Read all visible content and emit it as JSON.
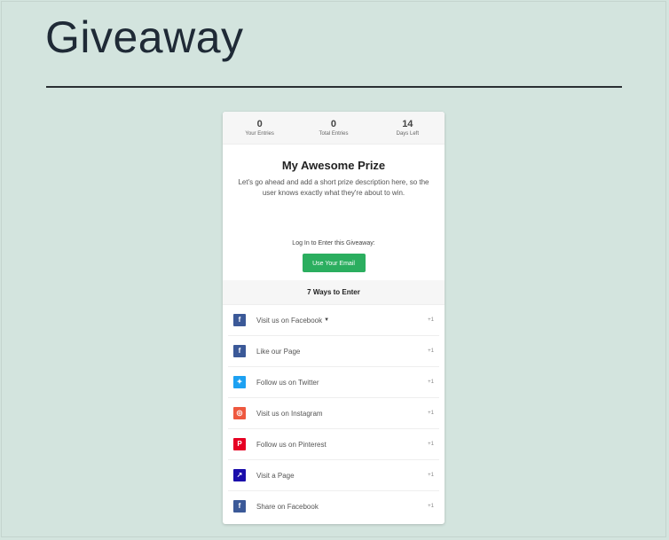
{
  "page": {
    "title": "Giveaway"
  },
  "stats": [
    {
      "value": "0",
      "label": "Your Entries"
    },
    {
      "value": "0",
      "label": "Total Entries"
    },
    {
      "value": "14",
      "label": "Days Left"
    }
  ],
  "prize": {
    "title": "My Awesome Prize",
    "description": "Let's go ahead and add a short prize description here, so the user knows exactly what they're about to win."
  },
  "login": {
    "label": "Log In to Enter this Giveaway:",
    "email_button": "Use Your Email"
  },
  "ways": {
    "header": "7 Ways to Enter",
    "items": [
      {
        "label": "Visit us on Facebook",
        "points": "+1",
        "icon": "facebook-icon",
        "color": "#3b5998",
        "glyph": "f",
        "expandable": true
      },
      {
        "label": "Like our Page",
        "points": "+1",
        "icon": "facebook-icon",
        "color": "#3b5998",
        "glyph": "f"
      },
      {
        "label": "Follow us on Twitter",
        "points": "+1",
        "icon": "twitter-icon",
        "color": "#1da1f2",
        "glyph": "✦"
      },
      {
        "label": "Visit us on Instagram",
        "points": "+1",
        "icon": "instagram-icon",
        "color": "#ee583f",
        "glyph": "◎"
      },
      {
        "label": "Follow us on Pinterest",
        "points": "+1",
        "icon": "pinterest-icon",
        "color": "#e60023",
        "glyph": "P"
      },
      {
        "label": "Visit a Page",
        "points": "+1",
        "icon": "external-link-icon",
        "color": "#1a0dab",
        "glyph": "↗"
      },
      {
        "label": "Share on Facebook",
        "points": "+1",
        "icon": "facebook-icon",
        "color": "#3b5998",
        "glyph": "f"
      }
    ]
  }
}
